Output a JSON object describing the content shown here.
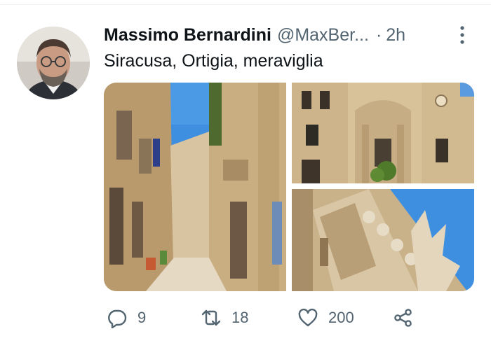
{
  "tweet": {
    "author": {
      "display_name": "Massimo Bernardini",
      "handle": "@MaxBer...",
      "avatar_icon": "profile-photo"
    },
    "separator": "·",
    "time": "2h",
    "text": "Siracusa, Ortigia, meraviglia",
    "media": [
      {
        "icon": "street-photo"
      },
      {
        "icon": "cathedral-facade-photo"
      },
      {
        "icon": "baroque-balcony-photo"
      }
    ],
    "actions": {
      "reply_count": "9",
      "retweet_count": "18",
      "like_count": "200"
    }
  },
  "colors": {
    "text_primary": "#0f1419",
    "text_secondary": "#536471",
    "sky": "#3f8fe0",
    "stone": "#d9c39b"
  }
}
